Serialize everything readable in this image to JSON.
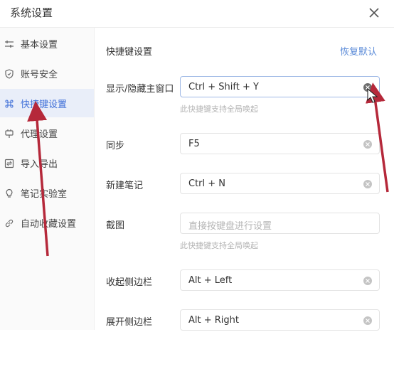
{
  "window": {
    "title": "系统设置"
  },
  "sidebar": {
    "items": [
      {
        "label": "基本设置",
        "icon": "sliders-icon"
      },
      {
        "label": "账号安全",
        "icon": "shield-icon"
      },
      {
        "label": "快捷键设置",
        "icon": "command-icon",
        "active": true
      },
      {
        "label": "代理设置",
        "icon": "plug-icon"
      },
      {
        "label": "导入导出",
        "icon": "import-export-icon"
      },
      {
        "label": "笔记实验室",
        "icon": "lightbulb-icon"
      },
      {
        "label": "自动收藏设置",
        "icon": "link-icon"
      }
    ]
  },
  "main": {
    "section_title": "快捷键设置",
    "restore_label": "恢复默认",
    "rows": [
      {
        "label": "显示/隐藏主窗口",
        "value": "Ctrl + Shift + Y",
        "hint": "此快捷键支持全局唤起"
      },
      {
        "label": "同步",
        "value": "F5"
      },
      {
        "label": "新建笔记",
        "value": "Ctrl + N"
      },
      {
        "label": "截图",
        "value": "",
        "placeholder": "直接按键盘进行设置",
        "hint": "此快捷键支持全局唤起"
      },
      {
        "label": "收起侧边栏",
        "value": "Alt + Left"
      },
      {
        "label": "展开侧边栏",
        "value": "Alt + Right"
      }
    ]
  },
  "colors": {
    "accent": "#3f6fd8",
    "link": "#5b8bd8",
    "active_bg": "#e9eef9",
    "annotation_arrow": "#b5283a"
  }
}
